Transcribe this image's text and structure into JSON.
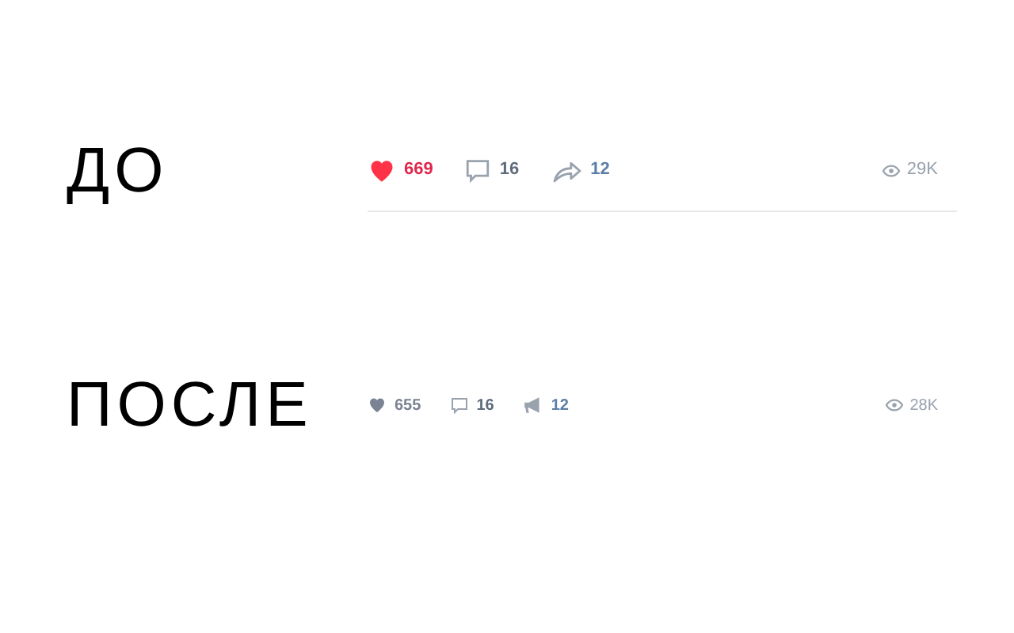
{
  "sections": [
    {
      "kind": "before",
      "label": "ДО",
      "like": {
        "count": "669",
        "liked": true
      },
      "comments": "16",
      "shares": "12",
      "views": "29K"
    },
    {
      "kind": "after",
      "label": "ПОСЛЕ",
      "like": {
        "count": "655",
        "liked": false
      },
      "comments": "16",
      "shares": "12",
      "views": "28K"
    }
  ]
}
